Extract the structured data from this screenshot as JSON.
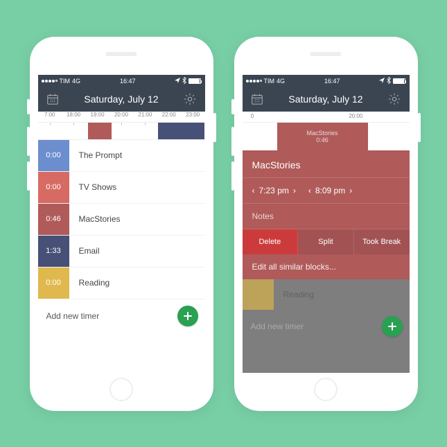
{
  "status": {
    "carrier": "TIM",
    "network": "4G",
    "time": "16:47"
  },
  "nav": {
    "title": "Saturday, July 12"
  },
  "left": {
    "axis_ticks": [
      "7:00",
      "18:00",
      "19:00",
      "20:00",
      "21:00",
      "22:00",
      "23:00"
    ],
    "blocks": [
      {
        "left_pct": 30,
        "width_pct": 14,
        "color": "#B05A5A"
      },
      {
        "left_pct": 72,
        "width_pct": 28,
        "color": "#475076"
      }
    ],
    "timers": [
      {
        "time": "0:00",
        "label": "The Prompt",
        "color": "#6C8ECF"
      },
      {
        "time": "0:00",
        "label": "TV Shows",
        "color": "#D76B63"
      },
      {
        "time": "0:46",
        "label": "MacStories",
        "color": "#B05A5A"
      },
      {
        "time": "1:33",
        "label": "Email",
        "color": "#475076"
      },
      {
        "time": "0:00",
        "label": "Reading",
        "color": "#E0B94E"
      }
    ],
    "add_label": "Add new timer"
  },
  "right": {
    "axis_left": "0",
    "axis_right": "20:00",
    "block_title": "MacStories",
    "block_time": "0:46",
    "detail": {
      "title": "MacStories",
      "start": "7:23 pm",
      "end": "8:09 pm",
      "notes_label": "Notes",
      "actions": {
        "delete": "Delete",
        "split": "Split",
        "break": "Took Break"
      },
      "edit_similar": "Edit all similar blocks..."
    },
    "behind_label": "Reading",
    "add_label": "Add new timer"
  }
}
